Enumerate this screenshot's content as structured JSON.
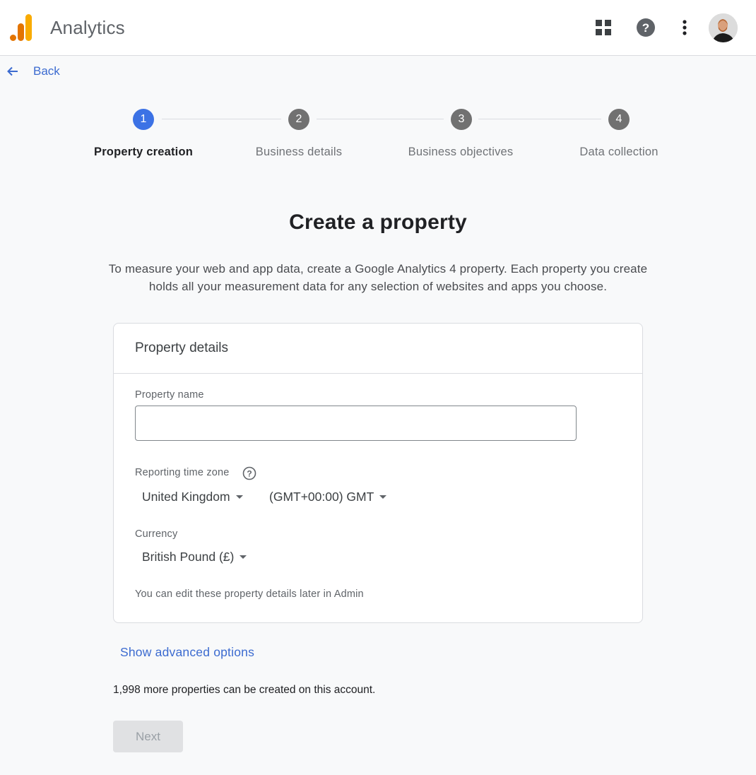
{
  "header": {
    "app_title": "Analytics",
    "logo_colors": [
      "#E37400",
      "#E8710A",
      "#F9AB00"
    ],
    "icons": [
      "apps-grid-icon",
      "help-icon",
      "more-vert-icon"
    ],
    "avatar_alt": "User avatar"
  },
  "nav": {
    "back_label": "Back"
  },
  "stepper": {
    "steps": [
      {
        "number": "1",
        "label": "Property creation",
        "state": "active"
      },
      {
        "number": "2",
        "label": "Business details",
        "state": "upcoming"
      },
      {
        "number": "3",
        "label": "Business objectives",
        "state": "upcoming"
      },
      {
        "number": "4",
        "label": "Data collection",
        "state": "upcoming"
      }
    ],
    "active_color": "#3C72E5",
    "inactive_color": "#717171"
  },
  "main": {
    "title": "Create a property",
    "intro": "To measure your web and app data, create a Google Analytics 4 property. Each property you create holds all your measurement data for any selection of websites and apps you choose."
  },
  "card": {
    "title": "Property details",
    "property_name": {
      "label": "Property name",
      "value": "",
      "placeholder": ""
    },
    "time_zone": {
      "label": "Reporting time zone",
      "country": "United Kingdom",
      "zone": "(GMT+00:00) GMT"
    },
    "currency": {
      "label": "Currency",
      "value": "British Pound (£)"
    },
    "note": "You can edit these property details later in Admin"
  },
  "footer": {
    "advanced_label": "Show advanced options",
    "quota_text": "1,998 more properties can be created on this account.",
    "next_label": "Next",
    "next_disabled": true
  },
  "colors": {
    "link": "#3C6BD0",
    "background": "#F8F9FA"
  }
}
